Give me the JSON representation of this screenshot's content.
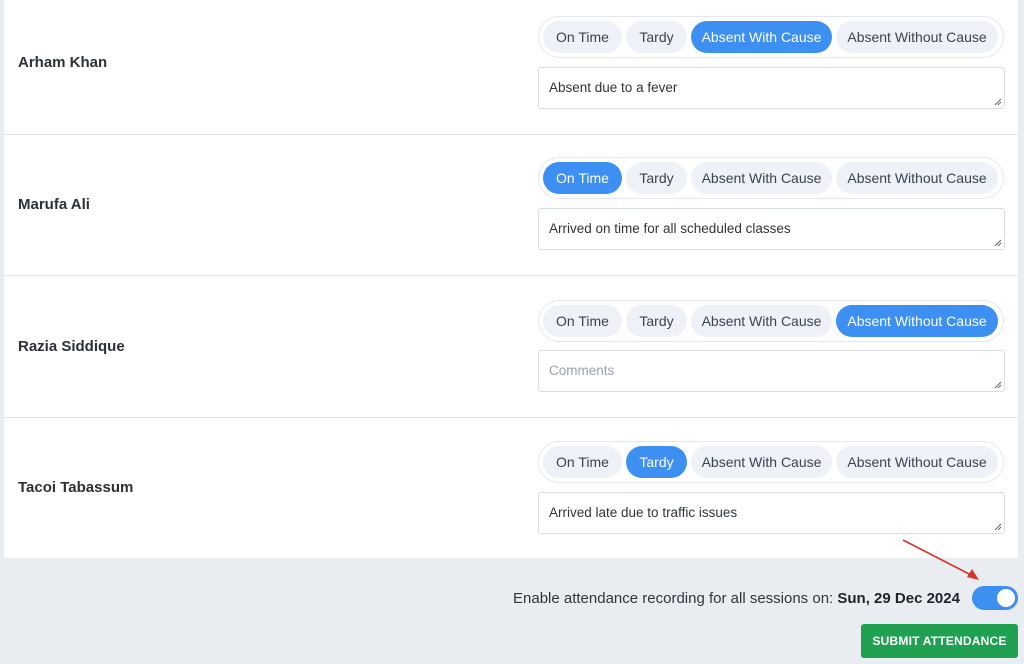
{
  "status_options": [
    "On Time",
    "Tardy",
    "Absent With Cause",
    "Absent Without Cause"
  ],
  "students": [
    {
      "name": "Arham Khan",
      "selected": "Absent With Cause",
      "comment": "Absent due to a fever",
      "comment_placeholder": ""
    },
    {
      "name": "Marufa Ali",
      "selected": "On Time",
      "comment": "Arrived on time for all scheduled classes",
      "comment_placeholder": ""
    },
    {
      "name": "Razia Siddique",
      "selected": "Absent Without Cause",
      "comment": "",
      "comment_placeholder": "Comments"
    },
    {
      "name": "Tacoi Tabassum",
      "selected": "Tardy",
      "comment": "Arrived late due to traffic issues",
      "comment_placeholder": ""
    }
  ],
  "footer": {
    "enable_label": "Enable attendance recording for all sessions on:",
    "date": "Sun, 29 Dec 2024",
    "toggle_on": true,
    "submit_label": "SUBMIT ATTENDANCE"
  },
  "colors": {
    "accent": "#3d8ff2",
    "submit": "#1fa151",
    "annotation_arrow": "#d9342b"
  }
}
